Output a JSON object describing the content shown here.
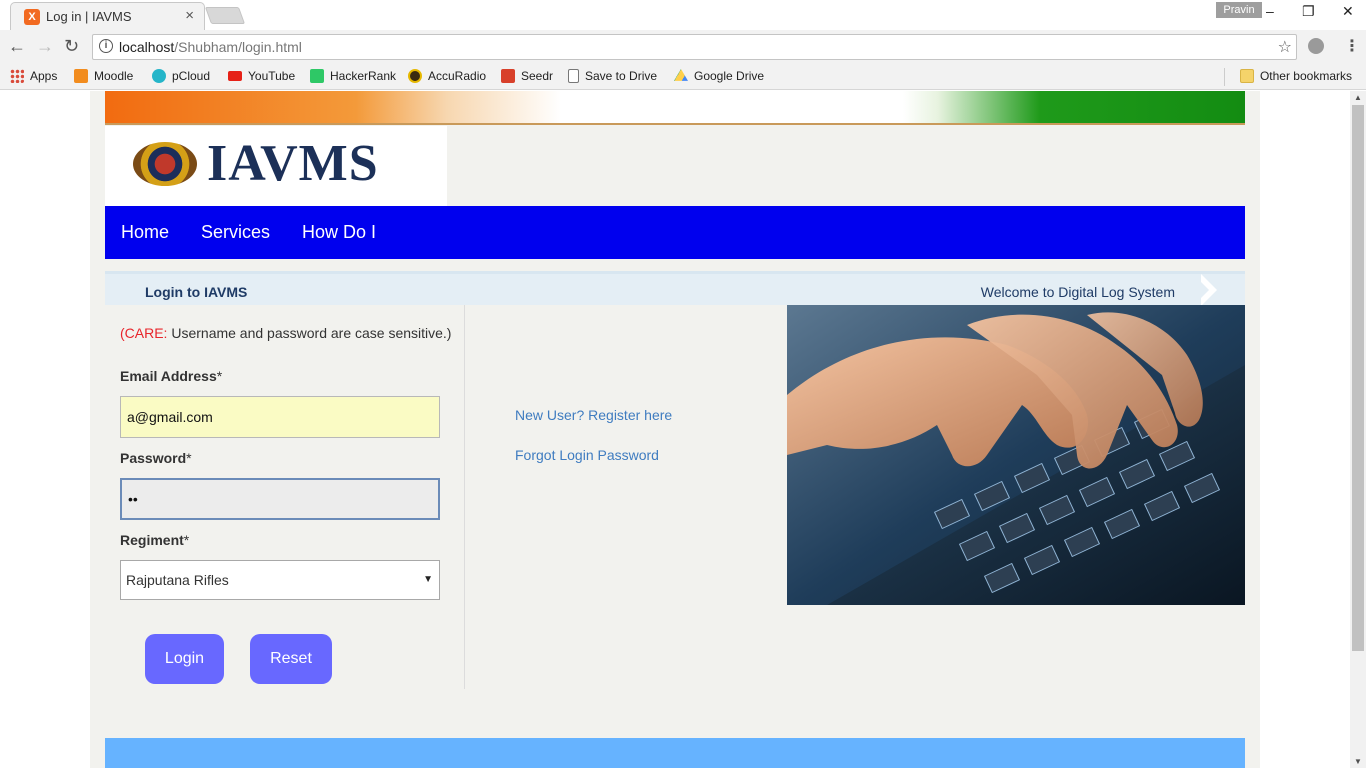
{
  "browser": {
    "tab_title": "Log in | IAVMS",
    "tab_favicon": "X",
    "close_tab": "×",
    "profile_name": "Pravin",
    "window": {
      "minimize": "–",
      "restore": "❐",
      "close": "✕"
    },
    "nav": {
      "back": "←",
      "forward": "→",
      "reload": "↻"
    },
    "url_host": "localhost",
    "url_path": "/Shubham/login.html",
    "info_icon": "i",
    "star_icon": "☆",
    "menu_icon": "⋮",
    "bookmarks": [
      {
        "label": "Apps",
        "icon_color": "#d94a3a"
      },
      {
        "label": "Moodle",
        "icon_color": "#f28c1e"
      },
      {
        "label": "pCloud",
        "icon_color": "#25b5c9"
      },
      {
        "label": "YouTube",
        "icon_color": "#e62117"
      },
      {
        "label": "HackerRank",
        "icon_color": "#2ec866"
      },
      {
        "label": "AccuRadio",
        "icon_color": "#3a2a10"
      },
      {
        "label": "Seedr",
        "icon_color": "#d8402a"
      },
      {
        "label": "Save to Drive",
        "icon_color": "#ffffff"
      },
      {
        "label": "Google Drive",
        "icon_color": "#1fa463"
      }
    ],
    "other_bookmarks": "Other bookmarks"
  },
  "site": {
    "logo_text": "IAVMS",
    "nav_items": [
      "Home",
      "Services",
      "How Do I"
    ],
    "subbar_title": "Login to IAVMS",
    "subbar_welcome": "Welcome to Digital Log System"
  },
  "form": {
    "care_prefix": "(CARE:",
    "care_text": " Username and password are case sensitive.)",
    "email_label": "Email Address",
    "email_value": "a@gmail.com",
    "password_label": "Password",
    "password_value": "••",
    "regiment_label": "Regiment",
    "regiment_value": "Rajputana Rifles",
    "required_marker": "*",
    "login_button": "Login",
    "reset_button": "Reset"
  },
  "links": {
    "register": "New User? Register here",
    "forgot": "Forgot Login Password"
  },
  "colors": {
    "navbar": "#0000ee",
    "button": "#6868ff",
    "footer": "#66b3ff",
    "link": "#3f7cc0",
    "care_red": "#e8252b"
  }
}
